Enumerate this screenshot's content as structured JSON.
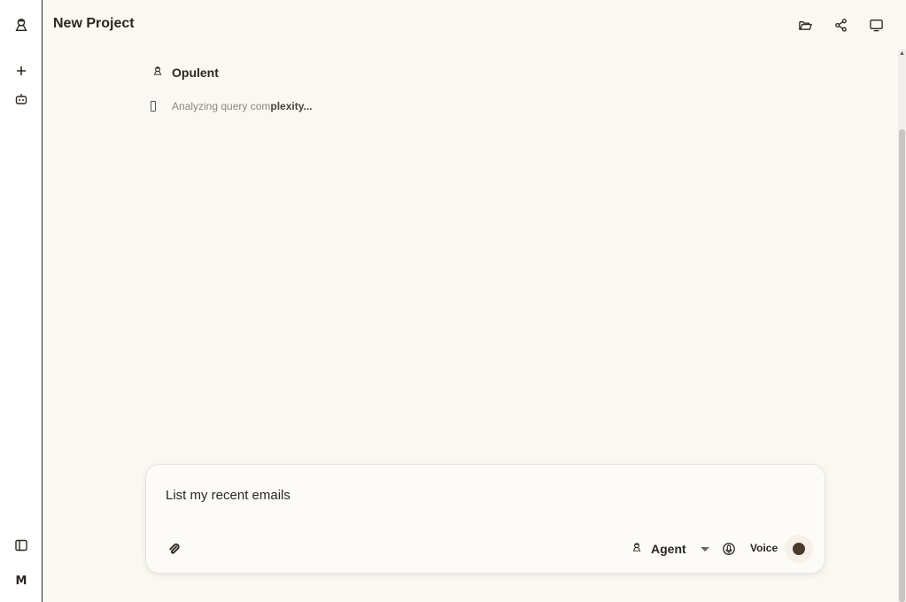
{
  "header": {
    "title": "New Project",
    "icons": [
      "folder-open-icon",
      "share-icon",
      "monitor-icon"
    ]
  },
  "sidebar": {
    "items": [
      {
        "name": "logo",
        "icon": "robot-logo-icon"
      },
      {
        "name": "new",
        "icon": "plus-icon"
      },
      {
        "name": "agents",
        "icon": "bot-icon"
      },
      {
        "name": "toggle-sidebar",
        "icon": "sidebar-panel-icon"
      },
      {
        "name": "user",
        "label": "M"
      }
    ]
  },
  "conversation": {
    "author": "Opulent",
    "status_dim": "Analyzing query com",
    "status_bold": "plexity..."
  },
  "composer": {
    "input_value": "List my recent emails",
    "agent_label": "Agent",
    "voice_label": "Voice"
  },
  "colors": {
    "background": "#fbf8f3",
    "text": "#2b2620",
    "voice_dot": "#4a3a2a"
  }
}
